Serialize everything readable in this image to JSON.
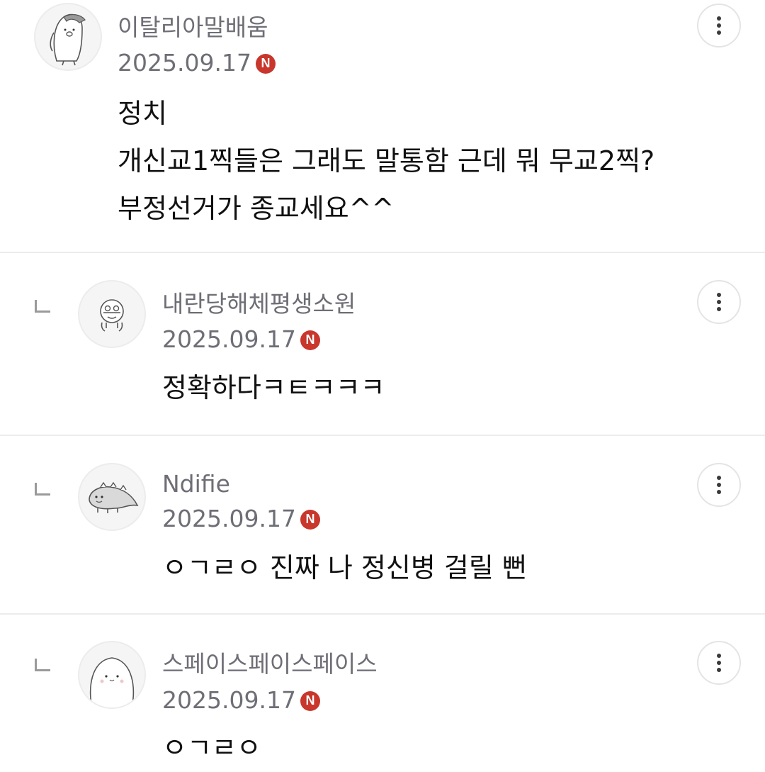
{
  "comments": [
    {
      "nickname": "이탈리아말배움",
      "date": "2025.09.17",
      "badge": "N",
      "lines": [
        "정치",
        "개신교1찍들은 그래도 말통함 근데 뭐 무교2찍?",
        "부정선거가 종교세요^^"
      ],
      "avatar_icon": "penguin-avatar-icon",
      "is_reply": false
    },
    {
      "nickname": "내란당해체평생소원",
      "date": "2025.09.17",
      "badge": "N",
      "lines": [
        "정확하다ㅋㅌㅋㅋㅋ"
      ],
      "avatar_icon": "round-creature-avatar-icon",
      "is_reply": true
    },
    {
      "nickname": "Ndifie",
      "date": "2025.09.17",
      "badge": "N",
      "lines": [
        "ㅇㄱㄹㅇ 진짜 나 정신병 걸릴 뻔"
      ],
      "avatar_icon": "dinosaur-avatar-icon",
      "is_reply": true
    },
    {
      "nickname": "스페이스페이스페이스",
      "date": "2025.09.17",
      "badge": "N",
      "lines": [
        "ㅇㄱㄹㅇ"
      ],
      "avatar_icon": "blob-avatar-icon",
      "is_reply": true
    }
  ],
  "colors": {
    "nickname": "#6e6e76",
    "new_badge": "#c8362c",
    "divider": "#ececec"
  },
  "icons": {
    "reply": "reply-arrow-icon",
    "more": "more-vertical-icon"
  }
}
